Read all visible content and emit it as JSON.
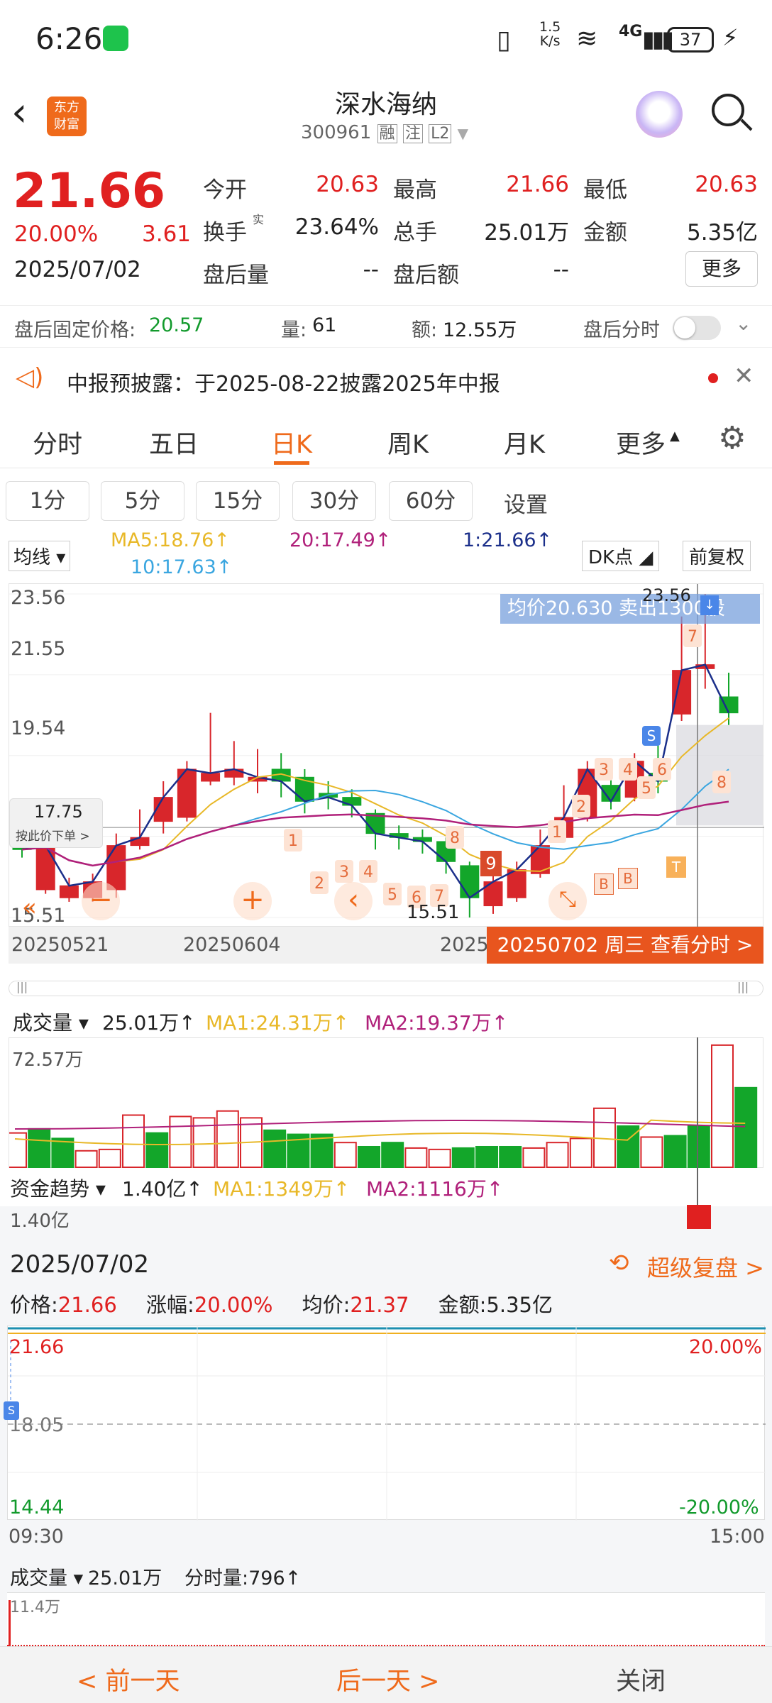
{
  "status": {
    "time": "6:26",
    "speed_top": "1.5",
    "speed_bottom": "K/s",
    "net": "4G",
    "battery": "37"
  },
  "nav": {
    "title": "深水海纳",
    "code": "300961",
    "tag1": "融",
    "tag2": "注",
    "tag3": "L2",
    "logo_top": "东方",
    "logo_bottom": "财富"
  },
  "quote": {
    "price": "21.66",
    "change_pct": "20.00%",
    "change": "3.61",
    "date": "2025/07/02",
    "open_label": "今开",
    "open": "20.63",
    "high_label": "最高",
    "high": "21.66",
    "low_label": "最低",
    "low": "20.63",
    "turnover_label": "换手",
    "turnover_sup": "实",
    "turnover": "23.64%",
    "volume_label": "总手",
    "volume": "25.01万",
    "amount_label": "金额",
    "amount": "5.35亿",
    "after_vol_label": "盘后量",
    "after_vol": "--",
    "after_amt_label": "盘后额",
    "after_amt": "--",
    "more": "更多"
  },
  "after_hours": {
    "price_label": "盘后固定价格:",
    "price": "20.57",
    "vol_label": "量:",
    "vol": "61",
    "amt_label": "额:",
    "amt": "12.55万",
    "toggle_label": "盘后分时"
  },
  "notice": {
    "text": "中报预披露：于2025-08-22披露2025年中报"
  },
  "tabs": [
    "分时",
    "五日",
    "日K",
    "周K",
    "月K",
    "更多"
  ],
  "subtabs": [
    "1分",
    "5分",
    "15分",
    "30分",
    "60分",
    "设置"
  ],
  "ma_legend": {
    "selector": "均线",
    "ma5": "MA5:18.76↑",
    "ma20": "20:17.49↑",
    "ma1": "1:21.66↑",
    "ma10": "10:17.63↑",
    "dk": "DK点",
    "fq": "前复权"
  },
  "kchart": {
    "y_labels": [
      "23.56",
      "21.55",
      "19.54",
      "15.51"
    ],
    "x_labels": [
      "20250521",
      "20250604",
      "2025"
    ],
    "avg_banner": "均价20.630  卖出1300股",
    "hi_label": "23.56",
    "lo_label": "15.51",
    "cross_price": "17.75",
    "cross_hint": "按此价下单 >",
    "date_tip": "20250702 周三 查看分时 >"
  },
  "volume_legend": {
    "selector": "成交量",
    "val": "25.01万↑",
    "ma1": "MA1:24.31万↑",
    "ma2": "MA2:19.37万↑",
    "axis": "72.57万"
  },
  "fund_legend": {
    "selector": "资金趋势",
    "val": "1.40亿↑",
    "ma1": "MA1:1349万↑",
    "ma2": "MA2:1116万↑",
    "axis": "1.40亿"
  },
  "panel2": {
    "date": "2025/07/02",
    "replay": "超级复盘 >",
    "price_label": "价格:",
    "price": "21.66",
    "chg_label": "涨幅:",
    "chg": "20.00%",
    "avg_label": "均价:",
    "avg": "21.37",
    "amt_label": "金额:",
    "amt": "5.35亿",
    "top_price": "21.66",
    "top_pct": "20.00%",
    "mid_price": "18.05",
    "bot_price": "14.44",
    "bot_pct": "-20.00%",
    "t_start": "09:30",
    "t_end": "15:00",
    "vol_selector": "成交量",
    "vol": "25.01万",
    "minute_vol": "分时量:796↑",
    "vol_axis": "11.4万"
  },
  "bottom": {
    "prev": "< 前一天",
    "next": "后一天 >",
    "close": "关闭"
  },
  "chart_data": {
    "type": "candlestick",
    "x_ticks": [
      "20250521",
      "20250604"
    ],
    "ylim": [
      15.51,
      23.56
    ],
    "candles": [
      {
        "o": 17.6,
        "c": 17.2,
        "h": 17.9,
        "l": 17.0
      },
      {
        "o": 16.2,
        "c": 17.3,
        "h": 17.4,
        "l": 16.1
      },
      {
        "o": 16.0,
        "c": 16.3,
        "h": 16.5,
        "l": 15.9
      },
      {
        "o": 16.0,
        "c": 16.4,
        "h": 16.6,
        "l": 15.9
      },
      {
        "o": 16.2,
        "c": 17.3,
        "h": 17.6,
        "l": 16.0
      },
      {
        "o": 17.3,
        "c": 17.5,
        "h": 18.2,
        "l": 17.2
      },
      {
        "o": 17.9,
        "c": 18.5,
        "h": 18.9,
        "l": 17.6
      },
      {
        "o": 18.0,
        "c": 19.2,
        "h": 19.4,
        "l": 17.9
      },
      {
        "o": 18.9,
        "c": 19.1,
        "h": 20.6,
        "l": 18.8
      },
      {
        "o": 19.0,
        "c": 19.2,
        "h": 19.9,
        "l": 18.8
      },
      {
        "o": 18.9,
        "c": 19.0,
        "h": 19.7,
        "l": 18.6
      },
      {
        "o": 19.2,
        "c": 18.9,
        "h": 19.6,
        "l": 18.5
      },
      {
        "o": 19.0,
        "c": 18.4,
        "h": 19.2,
        "l": 18.1
      },
      {
        "o": 18.6,
        "c": 18.5,
        "h": 18.9,
        "l": 18.2
      },
      {
        "o": 18.5,
        "c": 18.3,
        "h": 18.7,
        "l": 18.0
      },
      {
        "o": 18.1,
        "c": 17.6,
        "h": 18.2,
        "l": 17.2
      },
      {
        "o": 17.6,
        "c": 17.5,
        "h": 17.8,
        "l": 17.2
      },
      {
        "o": 17.5,
        "c": 17.4,
        "h": 17.7,
        "l": 17.1
      },
      {
        "o": 17.4,
        "c": 16.9,
        "h": 17.5,
        "l": 16.6
      },
      {
        "o": 16.8,
        "c": 16.0,
        "h": 16.9,
        "l": 15.51
      },
      {
        "o": 15.8,
        "c": 16.4,
        "h": 16.6,
        "l": 15.6
      },
      {
        "o": 16.0,
        "c": 16.7,
        "h": 16.9,
        "l": 15.9
      },
      {
        "o": 16.6,
        "c": 17.3,
        "h": 17.7,
        "l": 16.5
      },
      {
        "o": 17.5,
        "c": 18.0,
        "h": 18.8,
        "l": 17.4
      },
      {
        "o": 18.0,
        "c": 19.2,
        "h": 19.4,
        "l": 17.9
      },
      {
        "o": 18.8,
        "c": 18.4,
        "h": 19.1,
        "l": 18.2
      },
      {
        "o": 18.5,
        "c": 19.4,
        "h": 19.6,
        "l": 18.4
      },
      {
        "o": 19.1,
        "c": 18.9,
        "h": 20.2,
        "l": 18.6
      },
      {
        "o": 20.57,
        "c": 21.66,
        "h": 23.0,
        "l": 20.4
      },
      {
        "o": 21.7,
        "c": 21.8,
        "h": 23.56,
        "l": 21.2
      },
      {
        "o": 21.0,
        "c": 20.6,
        "h": 21.6,
        "l": 20.3
      }
    ]
  }
}
